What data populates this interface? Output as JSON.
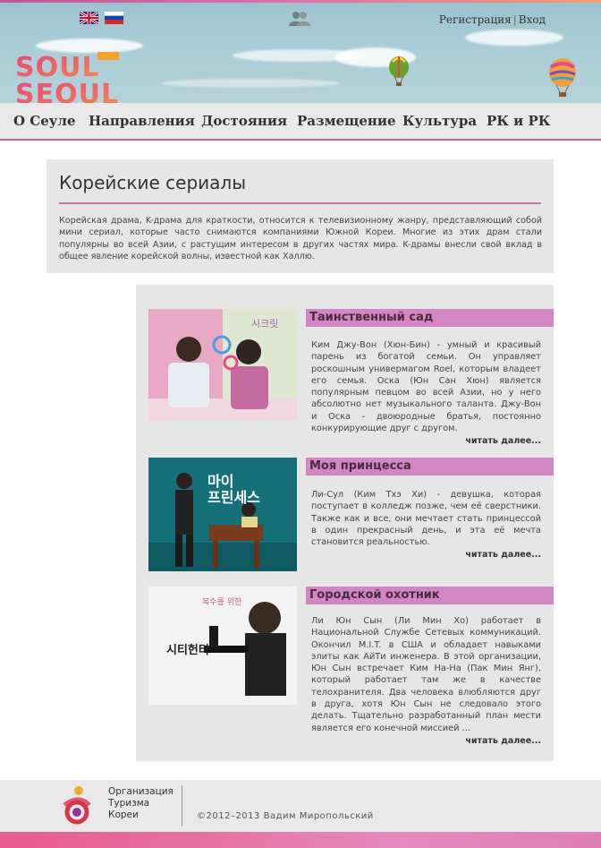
{
  "header": {
    "auth": {
      "register": "Регистрация",
      "login": "Вход"
    },
    "logo": {
      "line1": "SOUL",
      "line2": "SEOUL"
    }
  },
  "nav": {
    "items": [
      {
        "label": "О Сеуле"
      },
      {
        "label": "Направления"
      },
      {
        "label": "Достояния"
      },
      {
        "label": "Размещение"
      },
      {
        "label": "Культура"
      },
      {
        "label": "РК и РК"
      }
    ]
  },
  "intro": {
    "title": "Корейские сериалы",
    "text": "Корейская драма, K-драма для краткости, относится к телевизионному жанру, представляющий собой мини сериал, которые часто снимаются компаниями Южной Кореи. Многие из этих драм стали популярны во всей Азии, с растущим интересом в других частях мира. K-драмы внесли свой вклад в общее явление корейской волны, известной как Халлю."
  },
  "series": [
    {
      "title": "Таинственный сад",
      "text": "Ким Джу-Вон (Хюн-Бин) - умный и красивый парень из богатой семьи. Он управляет роскошным универмагом Roel, которым владеет его семья. Оска (Юн Сан Хюн) является популярным певцом во всей Азии, но у него абсолютно нет музыкального таланта. Джу-Вон и Оска - двоюродные братья, постоянно конкурирующие друг с другом.",
      "more": "читать далее..."
    },
    {
      "title": "Моя принцесса",
      "text": "Ли-Сул (Ким Тхэ Хи) - девушка, которая поступает в колледж позже, чем её сверстники. Также как и все, они мечтает стать принцессой в один прекрасный день, и эта её мечта становится реальностью.",
      "more": "читать далее..."
    },
    {
      "title": "Городской охотник",
      "text": "Ли Юн Сын (Ли Мин Хо) работает в Национальной Службе Сетевых коммуникаций. Окончил M.I.T. в США и обладает навыками элиты как АйТи инженера. В этой организации, Юн Сын встречает Ким На-На (Пак Мин Янг), который работает там же в качестве телохранителя. Два человека влюбляются друг в друга, хотя Юн Сын не следовало этого делать. Тщательно разработанный план мести является его конечной миссией ...",
      "more": "читать далее..."
    }
  ],
  "footer": {
    "org": [
      "Организация",
      "Туризма",
      "Кореи"
    ],
    "copyright": "©2012–2013 Вадим Миропольский"
  },
  "colors": {
    "accent": "#c25aa4",
    "title_bar": "#d286c3"
  }
}
